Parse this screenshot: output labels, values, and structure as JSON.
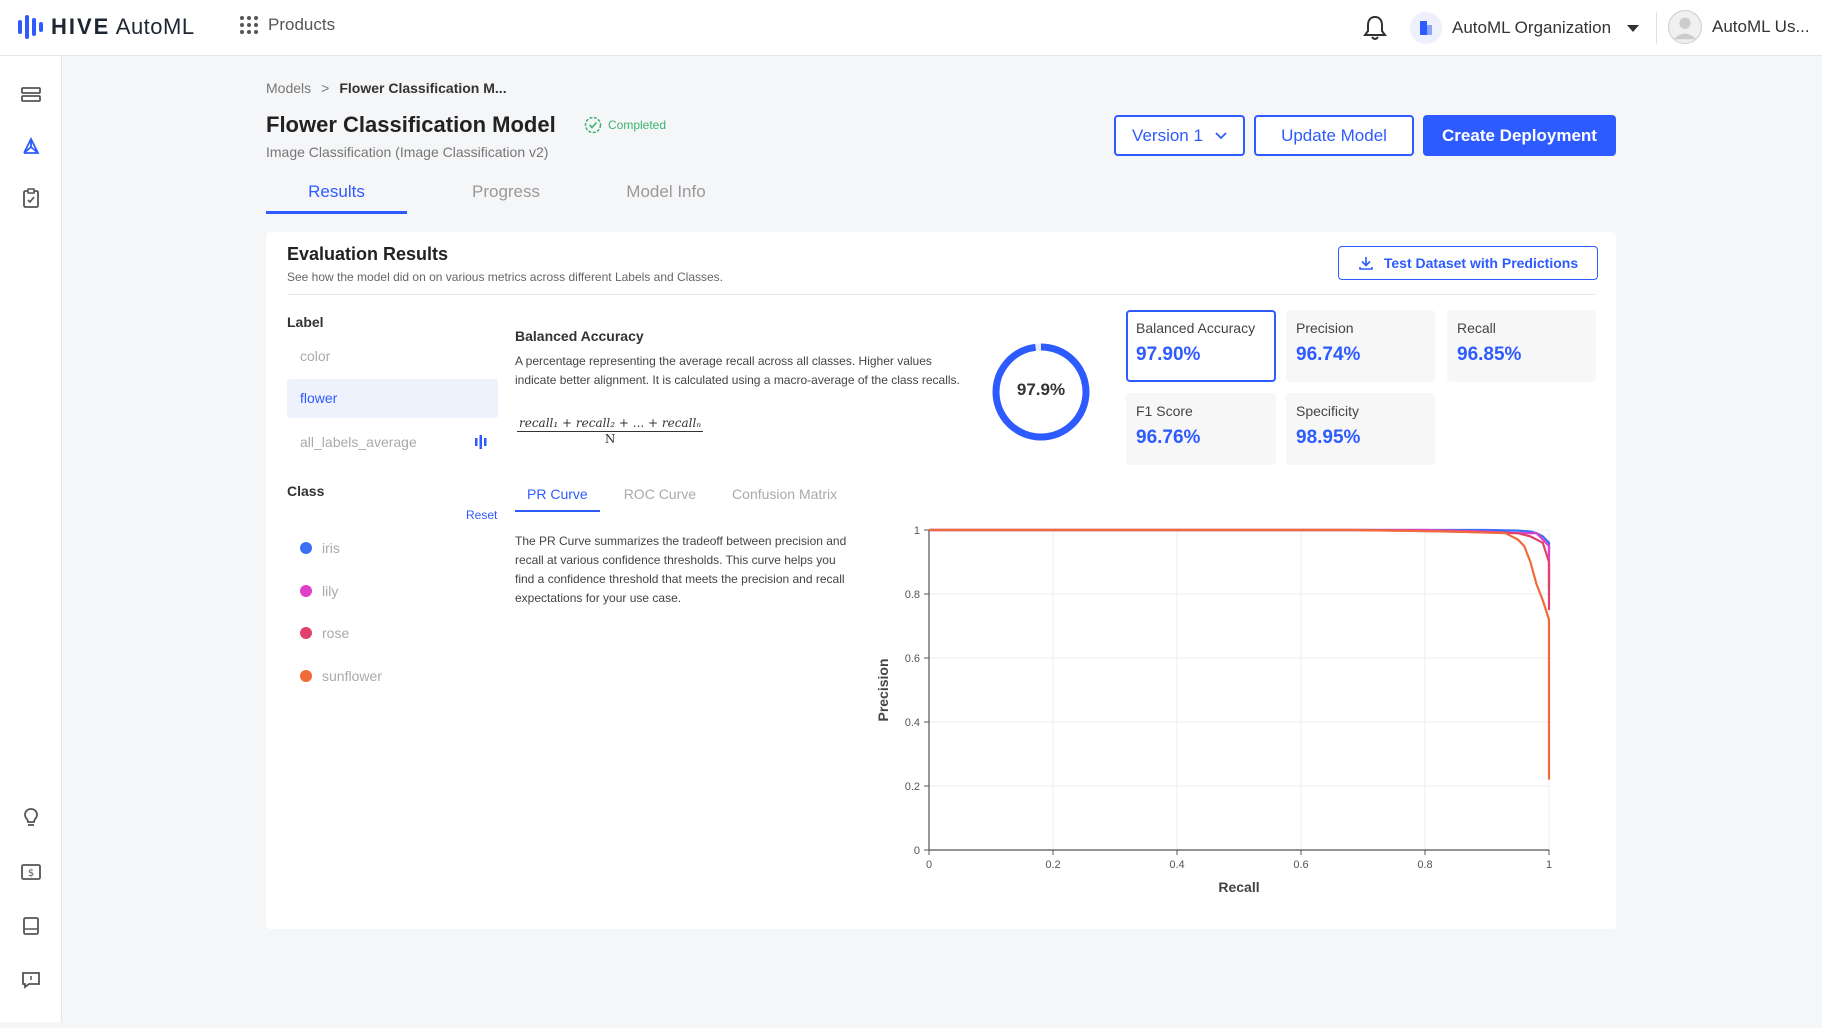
{
  "app": {
    "logo_bold": "HIVE",
    "logo_rest": "AutoML",
    "products_label": "Products"
  },
  "header": {
    "org_name": "AutoML Organization",
    "user_name": "AutoML Us..."
  },
  "breadcrumb": {
    "root": "Models",
    "separator": ">",
    "current": "Flower Classification M..."
  },
  "model": {
    "title": "Flower Classification Model",
    "status": "Completed",
    "subtitle": "Image Classification (Image Classification v2)"
  },
  "actions": {
    "version": "Version 1",
    "update": "Update Model",
    "create": "Create Deployment"
  },
  "tabs": [
    {
      "label": "Results"
    },
    {
      "label": "Progress"
    },
    {
      "label": "Model Info"
    }
  ],
  "evaluation": {
    "title": "Evaluation Results",
    "subtitle": "See how the model did on on various metrics across different Labels and Classes.",
    "download_label": "Test Dataset with Predictions",
    "label_heading": "Label",
    "labels": [
      {
        "name": "color"
      },
      {
        "name": "flower"
      },
      {
        "name": "all_labels_average"
      }
    ],
    "class_heading": "Class",
    "reset_label": "Reset",
    "classes": [
      {
        "name": "iris",
        "color": "#3b6ff5"
      },
      {
        "name": "lily",
        "color": "#e040c8"
      },
      {
        "name": "rose",
        "color": "#e0406a"
      },
      {
        "name": "sunflower",
        "color": "#f06a3a"
      }
    ],
    "metric_title": "Balanced Accuracy",
    "metric_desc": "A percentage representing the average recall across all classes. Higher values indicate better alignment. It is calculated using a macro-average of the class recalls.",
    "formula_num": "recall₁ + recall₂ + ... + recallₙ",
    "formula_den": "N",
    "donut_value": 0.979,
    "donut_label": "97.9%",
    "metrics": [
      {
        "name": "Balanced Accuracy",
        "value": "97.90%"
      },
      {
        "name": "Precision",
        "value": "96.74%"
      },
      {
        "name": "Recall",
        "value": "96.85%"
      },
      {
        "name": "F1 Score",
        "value": "96.76%"
      },
      {
        "name": "Specificity",
        "value": "98.95%"
      }
    ],
    "subtabs": [
      {
        "label": "PR Curve"
      },
      {
        "label": "ROC Curve"
      },
      {
        "label": "Confusion Matrix"
      }
    ],
    "pr_desc": "The PR Curve summarizes the tradeoff between precision and recall at various confidence thresholds. This curve helps you find a confidence threshold that meets the precision and recall expectations for your use case."
  },
  "colors": {
    "accent": "#2e5bff",
    "success": "#3cb371"
  },
  "icons": {
    "rail_top": [
      "layers-icon",
      "graph-icon",
      "clipboard-icon"
    ],
    "rail_bottom": [
      "lightbulb-icon",
      "dollar-icon",
      "book-icon",
      "chat-icon"
    ]
  },
  "chart_data": {
    "type": "line",
    "xlabel": "Recall",
    "ylabel": "Precision",
    "xlim": [
      0,
      1
    ],
    "ylim": [
      0,
      1
    ],
    "xticks": [
      "0",
      "0.2",
      "0.4",
      "0.6",
      "0.8",
      "1"
    ],
    "yticks": [
      "0",
      "0.2",
      "0.4",
      "0.6",
      "0.8",
      "1"
    ],
    "grid": true,
    "series": [
      {
        "color": "#3b6ff5",
        "x": [
          0,
          0.9,
          0.95,
          0.97,
          0.98,
          0.99,
          1.0,
          1.0
        ],
        "y": [
          1,
          1,
          0.998,
          0.995,
          0.99,
          0.98,
          0.96,
          0.93
        ]
      },
      {
        "color": "#e040c8",
        "x": [
          0,
          0.8,
          0.9,
          0.95,
          0.98,
          0.99,
          1.0,
          1.0
        ],
        "y": [
          1,
          1,
          0.995,
          0.99,
          0.99,
          0.97,
          0.95,
          0.82
        ]
      },
      {
        "color": "#e0406a",
        "x": [
          0,
          0.7,
          0.85,
          0.95,
          0.97,
          0.99,
          1.0,
          1.0
        ],
        "y": [
          1,
          1,
          0.995,
          0.99,
          0.98,
          0.96,
          0.9,
          0.75
        ]
      },
      {
        "color": "#f06a3a",
        "x": [
          0,
          0.68,
          0.85,
          0.93,
          0.95,
          0.96,
          0.97,
          0.98,
          0.99,
          1.0,
          1.0,
          1.0
        ],
        "y": [
          1,
          1,
          0.995,
          0.99,
          0.97,
          0.95,
          0.9,
          0.83,
          0.78,
          0.72,
          0.5,
          0.22
        ]
      }
    ]
  }
}
